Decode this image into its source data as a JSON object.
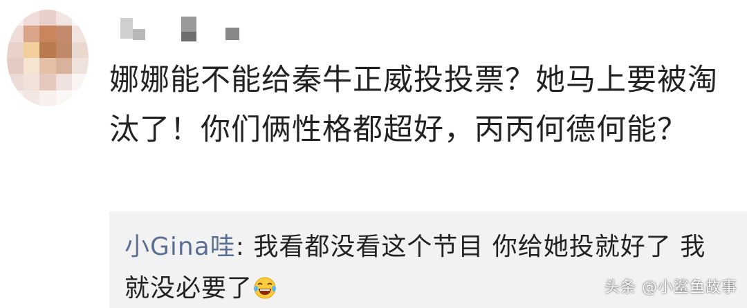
{
  "comment": {
    "text": "娜娜能不能给秦牛正威投投票？她马上要被淘汰了！你们俩性格都超好，丙丙何德何能？"
  },
  "reply": {
    "username": "小Gina哇",
    "separator": ": ",
    "text": "我看都没看这个节目  你给她投就好了  我就没必要了",
    "emoji": "laughing-with-tears-emoji"
  },
  "watermark": {
    "text": "头条 @小鲨鱼故事"
  },
  "colors": {
    "reply_username": "#5a6f93",
    "reply_background": "#f2f2f2",
    "text": "#222222"
  }
}
